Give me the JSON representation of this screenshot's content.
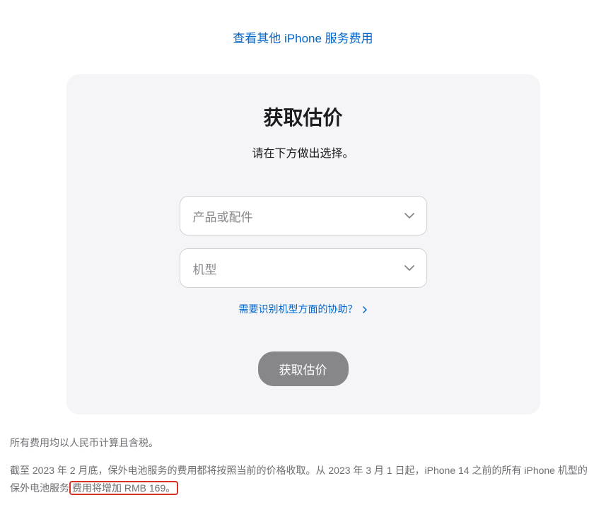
{
  "topLink": {
    "label": "查看其他 iPhone 服务费用"
  },
  "card": {
    "title": "获取估价",
    "subtitle": "请在下方做出选择。",
    "select1": {
      "placeholder": "产品或配件"
    },
    "select2": {
      "placeholder": "机型"
    },
    "helpLink": {
      "label": "需要识别机型方面的协助？"
    },
    "button": {
      "label": "获取估价"
    }
  },
  "notes": {
    "line1": "所有费用均以人民币计算且含税。",
    "line2_part1": "截至 2023 年 2 月底，保外电池服务的费用都将按照当前的价格收取。从 2023 年 3 月 1 日起，iPhone 14 之前的所有 iPhone 机型的保外电池服务",
    "line2_highlight": "费用将增加 RMB 169。"
  }
}
